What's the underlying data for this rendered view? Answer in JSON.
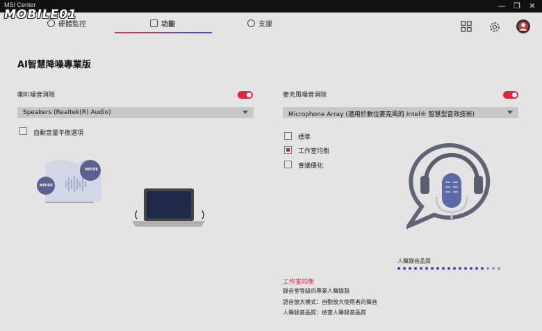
{
  "window": {
    "app_name": "MSI Center",
    "watermark": "MOBILE01",
    "controls": [
      "—",
      "❐",
      "✕"
    ]
  },
  "tabs": [
    {
      "label": "硬體監控",
      "icon": "clock-icon"
    },
    {
      "label": "功能",
      "icon": "feature-icon"
    },
    {
      "label": "支援",
      "icon": "info-icon"
    }
  ],
  "page_title": "AI智慧降噪專業版",
  "speaker": {
    "label": "喇叭噪音消除",
    "toggle_on": true,
    "device": "Speakers (Realtek(R) Audio)",
    "auto_volume_label": "自動音量平衡選項"
  },
  "microphone": {
    "label": "麥克風噪音消除",
    "toggle_on": true,
    "device": "Microphone Array (適用於數位麥克風的 Intel® 智慧型音效技術)",
    "modes": [
      {
        "label": "標準",
        "checked": false
      },
      {
        "label": "工作室均衡",
        "checked": true
      },
      {
        "label": "會議優化",
        "checked": false
      }
    ]
  },
  "illustration": {
    "noise_label_1": "NOISE",
    "noise_label_2": "NOISE"
  },
  "quality": {
    "label": "人聲錄音品質",
    "level_filled": 16,
    "level_total": 19
  },
  "description": {
    "title": "工作室均衡",
    "lines": [
      "錄音室等級的專業人聲錄製",
      "語音放大模式：自動放大使用者的聲音",
      "人聲錄音品質：檢查人聲錄音品質"
    ]
  },
  "colors": {
    "accent": "#d2233a",
    "toggle": "#e0253f",
    "dot_active": "#3b4fa8",
    "dot_inactive": "#9a9aa8"
  }
}
